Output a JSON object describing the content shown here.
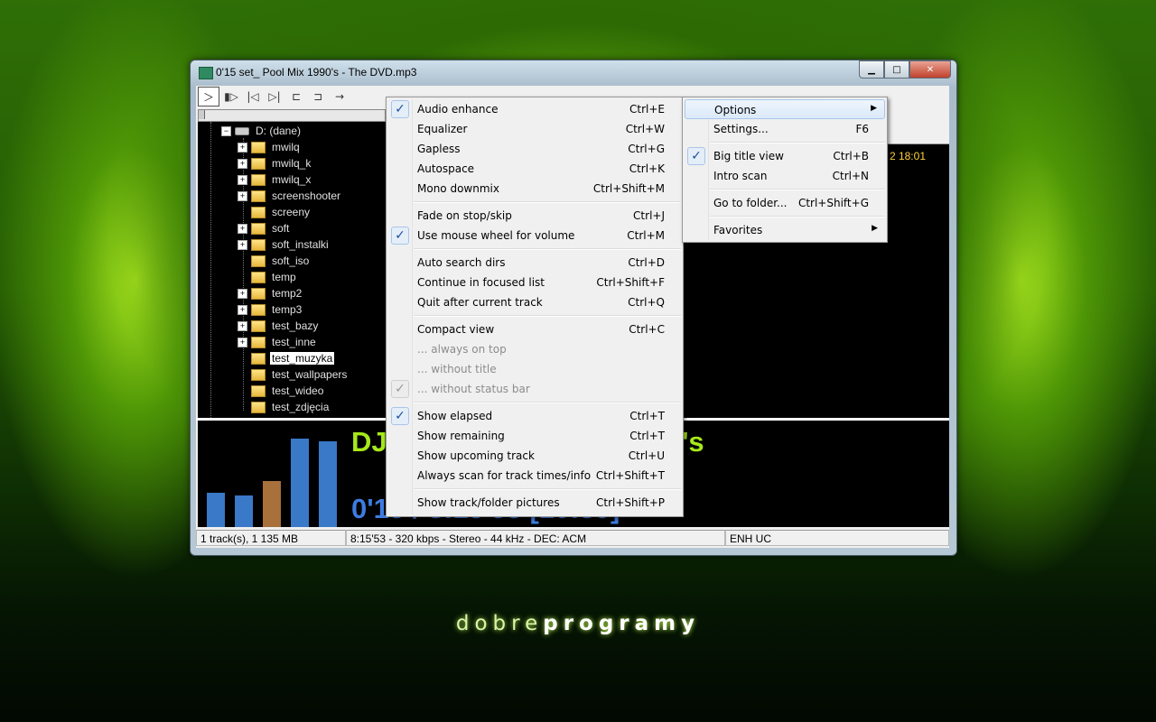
{
  "window": {
    "title": "0'15 set_ Pool Mix 1990's - The DVD.mp3",
    "min": "▁",
    "max": "□",
    "close": "✕"
  },
  "toolbar": [
    {
      "name": "play-button",
      "glyph": "＞"
    },
    {
      "name": "pause-button",
      "glyph": "▮▷"
    },
    {
      "name": "prev-button",
      "glyph": "|◁"
    },
    {
      "name": "next-button",
      "glyph": "▷|"
    },
    {
      "name": "back-folder-button",
      "glyph": "⊏"
    },
    {
      "name": "forward-folder-button",
      "glyph": "⊐"
    },
    {
      "name": "goto-button",
      "glyph": "→"
    }
  ],
  "tree": {
    "drive": "D: (dane)",
    "folders": [
      {
        "label": "mwilq",
        "plus": true
      },
      {
        "label": "mwilq_k",
        "plus": true
      },
      {
        "label": "mwilq_x",
        "plus": true
      },
      {
        "label": "screenshooter",
        "plus": true
      },
      {
        "label": "screeny",
        "plus": false
      },
      {
        "label": "soft",
        "plus": true
      },
      {
        "label": "soft_instalki",
        "plus": true
      },
      {
        "label": "soft_iso",
        "plus": false
      },
      {
        "label": "temp",
        "plus": false
      },
      {
        "label": "temp2",
        "plus": true
      },
      {
        "label": "temp3",
        "plus": true
      },
      {
        "label": "test_bazy",
        "plus": true
      },
      {
        "label": "test_inne",
        "plus": true
      },
      {
        "label": "test_muzyka",
        "plus": false,
        "selected": true
      },
      {
        "label": "test_wallpapers",
        "plus": false
      },
      {
        "label": "test_wideo",
        "plus": false
      },
      {
        "label": "test_zdjęcia",
        "plus": false
      }
    ]
  },
  "list": {
    "date_text": "2 18:01"
  },
  "now_playing": {
    "title_left": "DJ",
    "title_right": "'s",
    "time": "0'15 / 8:15'53   [10:59]",
    "spectrum_colors": [
      "#3a78c8",
      "#3a78c8",
      "#a8703a",
      "#3a78c8",
      "#3a78c8"
    ]
  },
  "statusbar": {
    "tracks": "1 track(s), 1 135 MB",
    "info": "8:15'53 - 320 kbps - Stereo - 44 kHz - DEC: ACM",
    "keys": "ENH  UC"
  },
  "main_menu": [
    {
      "label": "Options",
      "submenu": true,
      "highlighted": true
    },
    {
      "label": "Settings...",
      "shortcut": "F6"
    },
    {
      "sep": true
    },
    {
      "label": "Big title view",
      "shortcut": "Ctrl+B",
      "checked": true
    },
    {
      "label": "Intro scan",
      "shortcut": "Ctrl+N"
    },
    {
      "sep": true
    },
    {
      "label": "Go to folder...",
      "shortcut": "Ctrl+Shift+G"
    },
    {
      "sep": true
    },
    {
      "label": "Favorites",
      "submenu": true
    }
  ],
  "options_menu": [
    {
      "label": "Audio enhance",
      "shortcut": "Ctrl+E",
      "checked": true
    },
    {
      "label": "Equalizer",
      "shortcut": "Ctrl+W"
    },
    {
      "label": "Gapless",
      "shortcut": "Ctrl+G"
    },
    {
      "label": "Autospace",
      "shortcut": "Ctrl+K"
    },
    {
      "label": "Mono downmix",
      "shortcut": "Ctrl+Shift+M"
    },
    {
      "sep": true
    },
    {
      "label": "Fade on stop/skip",
      "shortcut": "Ctrl+J"
    },
    {
      "label": "Use mouse wheel for volume",
      "shortcut": "Ctrl+M",
      "checked": true
    },
    {
      "sep": true
    },
    {
      "label": "Auto search dirs",
      "shortcut": "Ctrl+D"
    },
    {
      "label": "Continue in focused list",
      "shortcut": "Ctrl+Shift+F"
    },
    {
      "label": "Quit after current track",
      "shortcut": "Ctrl+Q"
    },
    {
      "sep": true
    },
    {
      "label": "Compact view",
      "shortcut": "Ctrl+C"
    },
    {
      "label": "... always on top",
      "disabled": true
    },
    {
      "label": "... without title",
      "disabled": true
    },
    {
      "label": "... without status bar",
      "disabled": true,
      "checked": true
    },
    {
      "sep": true
    },
    {
      "label": "Show elapsed",
      "shortcut": "Ctrl+T",
      "checked": true
    },
    {
      "label": "Show remaining",
      "shortcut": "Ctrl+T"
    },
    {
      "label": "Show upcoming track",
      "shortcut": "Ctrl+U"
    },
    {
      "label": "Always scan for track times/info",
      "shortcut": "Ctrl+Shift+T"
    },
    {
      "sep": true
    },
    {
      "label": "Show track/folder pictures",
      "shortcut": "Ctrl+Shift+P"
    }
  ],
  "wallpaper": {
    "brand_light": "dobre",
    "brand_bold": "programy"
  }
}
